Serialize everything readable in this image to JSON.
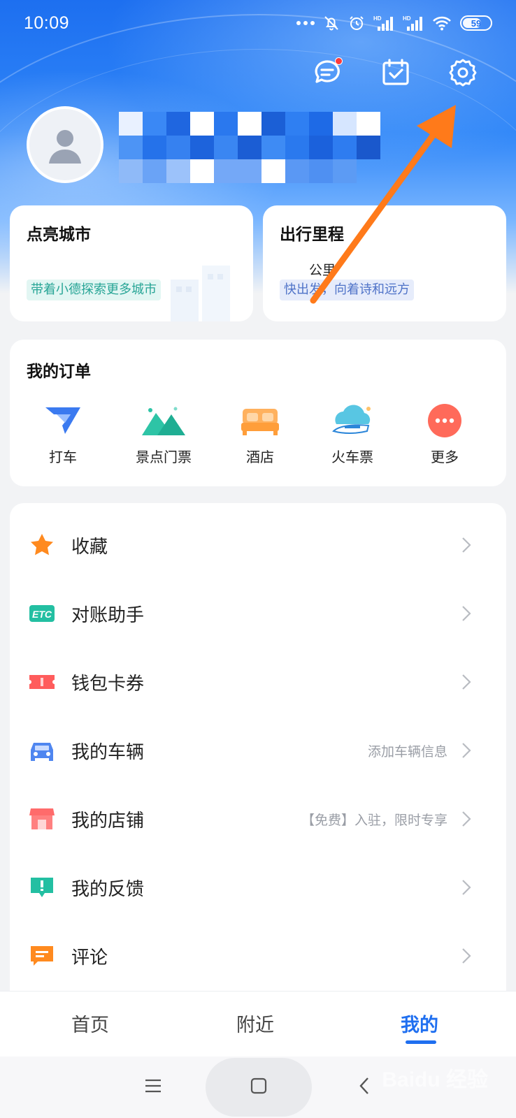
{
  "status_bar": {
    "time": "10:09",
    "battery": "59",
    "icons": [
      "more-dots-icon",
      "mute-icon",
      "alarm-icon",
      "signal-hd-icon",
      "signal-hd-icon",
      "wifi-icon",
      "battery-icon"
    ],
    "hd_label": "HD"
  },
  "header": {
    "actions": [
      "message-icon",
      "checkin-calendar-icon",
      "settings-icon"
    ],
    "message_has_badge": true
  },
  "stats": {
    "cities": {
      "title": "点亮城市",
      "tag": "带着小德探索更多城市"
    },
    "mileage": {
      "title": "出行里程",
      "unit": "公里",
      "tag": "快出发，向着诗和远方"
    }
  },
  "orders": {
    "title": "我的订单",
    "items": [
      {
        "label": "打车",
        "icon": "taxi-icon"
      },
      {
        "label": "景点门票",
        "icon": "scenic-ticket-icon"
      },
      {
        "label": "酒店",
        "icon": "hotel-bed-icon"
      },
      {
        "label": "火车票",
        "icon": "train-ticket-icon"
      },
      {
        "label": "更多",
        "icon": "more-icon"
      }
    ]
  },
  "menu": [
    {
      "label": "收藏",
      "icon": "star-icon",
      "hint": ""
    },
    {
      "label": "对账助手",
      "icon": "etc-icon",
      "icon_text": "ETC",
      "hint": ""
    },
    {
      "label": "钱包卡券",
      "icon": "coupon-icon",
      "hint": ""
    },
    {
      "label": "我的车辆",
      "icon": "car-icon",
      "hint": "添加车辆信息"
    },
    {
      "label": "我的店铺",
      "icon": "shop-icon",
      "hint": "【免费】入驻，限时专享"
    },
    {
      "label": "我的反馈",
      "icon": "feedback-icon",
      "hint": ""
    },
    {
      "label": "评论",
      "icon": "comment-icon",
      "hint": ""
    }
  ],
  "tabs": [
    {
      "label": "首页",
      "active": false
    },
    {
      "label": "附近",
      "active": false
    },
    {
      "label": "我的",
      "active": true
    }
  ],
  "nav": [
    "menu-icon",
    "home-icon",
    "back-icon"
  ],
  "watermark": "Baidu 经验",
  "colors": {
    "brand_blue": "#1f6ff0",
    "annotation_arrow": "#ff7a1a",
    "cities_tag_bg": "#e2f6f3",
    "cities_tag_fg": "#28a596",
    "mileage_tag_bg": "#e6ecfb",
    "mileage_tag_fg": "#4f73c8"
  }
}
